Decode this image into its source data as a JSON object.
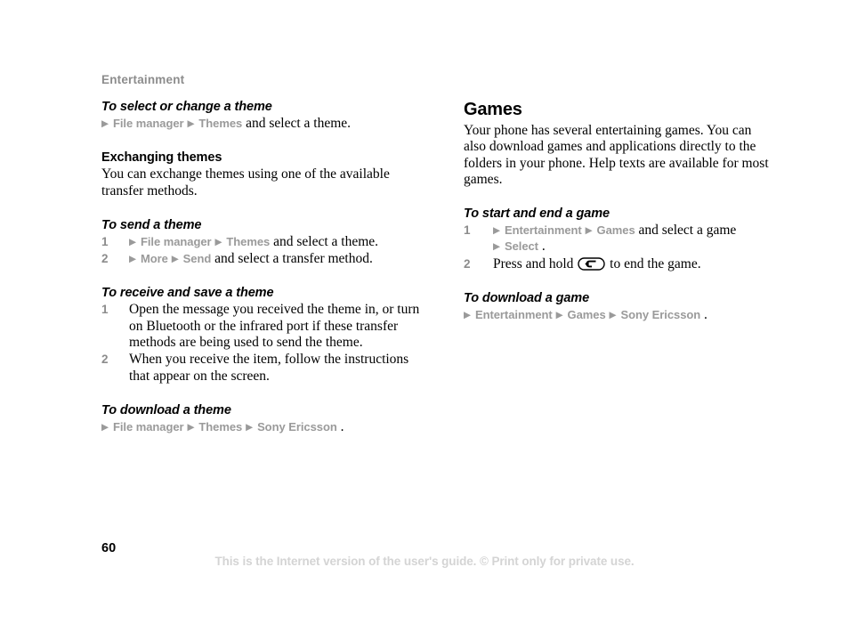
{
  "running_head": "Entertainment",
  "left_column": {
    "proc_select_theme": {
      "title": "To select or change a theme",
      "path": [
        {
          "type": "arrow",
          "text": "▶"
        },
        {
          "type": "menu",
          "text": "File manager"
        },
        {
          "type": "arrow",
          "text": "▶"
        },
        {
          "type": "menu",
          "text": "Themes"
        },
        {
          "type": "plain",
          "text": " and select a theme."
        }
      ]
    },
    "sub_exchanging": {
      "title": "Exchanging themes",
      "body": "You can exchange themes using one of the available transfer methods."
    },
    "proc_send_theme": {
      "title": "To send a theme",
      "steps": [
        {
          "num": "1",
          "parts": [
            {
              "type": "arrow",
              "text": "▶"
            },
            {
              "type": "menu",
              "text": "File manager"
            },
            {
              "type": "arrow",
              "text": "▶"
            },
            {
              "type": "menu",
              "text": "Themes"
            },
            {
              "type": "plain",
              "text": " and select a theme."
            }
          ]
        },
        {
          "num": "2",
          "parts": [
            {
              "type": "arrow",
              "text": "▶"
            },
            {
              "type": "menu",
              "text": "More"
            },
            {
              "type": "arrow",
              "text": "▶"
            },
            {
              "type": "menu",
              "text": "Send"
            },
            {
              "type": "plain",
              "text": " and select a transfer method."
            }
          ]
        }
      ]
    },
    "proc_receive_theme": {
      "title": "To receive and save a theme",
      "steps": [
        {
          "num": "1",
          "parts": [
            {
              "type": "plain",
              "text": "Open the message you received the theme in, or turn on Bluetooth or the infrared port if these transfer methods are being used to send the theme."
            }
          ]
        },
        {
          "num": "2",
          "parts": [
            {
              "type": "plain",
              "text": "When you receive the item, follow the instructions that appear on the screen."
            }
          ]
        }
      ]
    },
    "proc_download_theme": {
      "title": "To download a theme",
      "path": [
        {
          "type": "arrow",
          "text": "▶"
        },
        {
          "type": "menu",
          "text": "File manager"
        },
        {
          "type": "arrow",
          "text": "▶"
        },
        {
          "type": "menu",
          "text": "Themes"
        },
        {
          "type": "arrow",
          "text": "▶"
        },
        {
          "type": "menu",
          "text": "Sony Ericsson"
        },
        {
          "type": "plain",
          "text": "."
        }
      ]
    }
  },
  "right_column": {
    "section_games": {
      "title": "Games",
      "body": "Your phone has several entertaining games. You can also download games and applications directly to the folders in your phone. Help texts are available for most games."
    },
    "proc_start_end_game": {
      "title": "To start and end a game",
      "steps": [
        {
          "num": "1",
          "parts": [
            {
              "type": "arrow",
              "text": "▶"
            },
            {
              "type": "menu",
              "text": "Entertainment"
            },
            {
              "type": "arrow",
              "text": "▶"
            },
            {
              "type": "menu",
              "text": "Games"
            },
            {
              "type": "plain",
              "text": " and select a game"
            },
            {
              "type": "break"
            },
            {
              "type": "arrow",
              "text": "▶"
            },
            {
              "type": "menu",
              "text": "Select"
            },
            {
              "type": "plain",
              "text": "."
            }
          ]
        },
        {
          "num": "2",
          "parts": [
            {
              "type": "plain",
              "text": "Press and hold "
            },
            {
              "type": "backkey",
              "text": "back-key"
            },
            {
              "type": "plain",
              "text": " to end the game."
            }
          ]
        }
      ]
    },
    "proc_download_game": {
      "title": "To download a game",
      "path": [
        {
          "type": "arrow",
          "text": "▶"
        },
        {
          "type": "menu",
          "text": "Entertainment"
        },
        {
          "type": "arrow",
          "text": "▶"
        },
        {
          "type": "menu",
          "text": "Games"
        },
        {
          "type": "arrow",
          "text": "▶"
        },
        {
          "type": "menu",
          "text": "Sony Ericsson"
        },
        {
          "type": "plain",
          "text": "."
        }
      ]
    }
  },
  "footer": {
    "page_number": "60",
    "disclaimer": "This is the Internet version of the user's guide. © Print only for private use."
  },
  "colors": {
    "running_head": "#8c8c8c",
    "menu_text": "#9a9a9a",
    "step_number": "#8c8c8c",
    "body_text": "#000000",
    "disclaimer": "#d4d4d4",
    "page_background": "#ffffff"
  }
}
